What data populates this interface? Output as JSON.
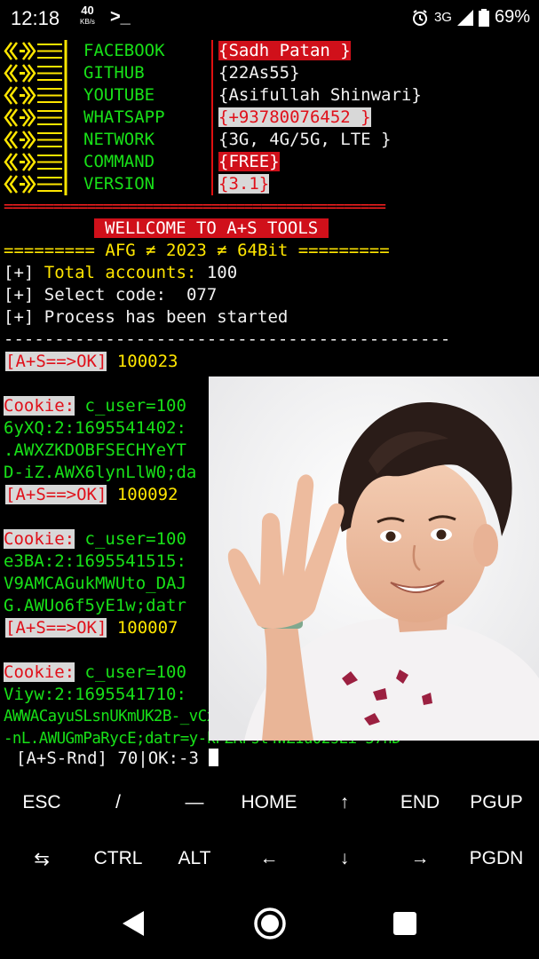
{
  "status_bar": {
    "time": "12:18",
    "speed_value": "40",
    "speed_unit": "KB/s",
    "terminal_glyph": ">_",
    "network": "3G",
    "battery": "69%"
  },
  "info": [
    {
      "label": "FACEBOOK",
      "value": "{Sadh Patan }",
      "style": "redbg"
    },
    {
      "label": "GITHUB",
      "value": "{22As55}",
      "style": "white"
    },
    {
      "label": "YOUTUBE",
      "value": "{Asifullah Shinwari}",
      "style": "white"
    },
    {
      "label": "WHATSAPP",
      "value": "{+93780076452 }",
      "style": "graybg"
    },
    {
      "label": "NETWORK",
      "value": "{3G, 4G/5G, LTE }",
      "style": "white"
    },
    {
      "label": "COMMAND",
      "value": "{FREE}",
      "style": "redbg"
    },
    {
      "label": "VERSION",
      "value": "{3.1}",
      "style": "graybg"
    }
  ],
  "separator": "==============================================",
  "welcome": "WELLCOME TO A+S TOOLS",
  "afg_line": "========= AFG ≠ 2023 ≠ 64Bit =========",
  "stats": {
    "prefix": "[+]",
    "total_label": "Total accounts:",
    "total_value": "100",
    "select_label": "Select code:",
    "select_value": "077",
    "process": "Process has been started"
  },
  "dash_line": "--------------------------------------------",
  "results": [
    {
      "tag": "[A+S==>OK]",
      "id": "100023",
      "cookie_label": "Cookie:",
      "cookie_start": "c_user=100",
      "lines": [
        "6yXQ:2:1695541402:",
        ".AWXZKDOBFSECHYeYT",
        "D-iZ.AWX6lynLlW0;da"
      ]
    },
    {
      "tag": "[A+S==>OK]",
      "id": "100092",
      "cookie_label": "Cookie:",
      "cookie_start": "c_user=100",
      "lines": [
        "e3BA:2:1695541515:",
        "V9AMCAGukMWUto_DAJ",
        "G.AWUo6f5yE1w;datr"
      ]
    },
    {
      "tag": "[A+S==>OK]",
      "id": "100007",
      "cookie_label": "Cookie:",
      "cookie_start": "c_user=100",
      "lines": [
        "Viyw:2:1695541710:",
        "AWWACayuSLsnUKmUK2B-_vCxx40.BlD-nL..AAA.0.0.BlD",
        "-nL.AWUGmPaRycE;datr=y-kPZRFst4WZ1u02sEi-57hD"
      ]
    }
  ],
  "prompt": "[A+S-Rnd] 70|OK:-3",
  "extra_keys_row1": [
    "ESC",
    "/",
    "—",
    "HOME",
    "↑",
    "END",
    "PGUP"
  ],
  "extra_keys_row2": [
    "⇆",
    "CTRL",
    "ALT",
    "←",
    "↓",
    "→",
    "PGDN"
  ],
  "nav_icons": [
    "back-icon",
    "home-icon",
    "recents-icon"
  ],
  "colors": {
    "green": "#18e018",
    "yellow": "#ffe600",
    "red": "#d0101a"
  }
}
